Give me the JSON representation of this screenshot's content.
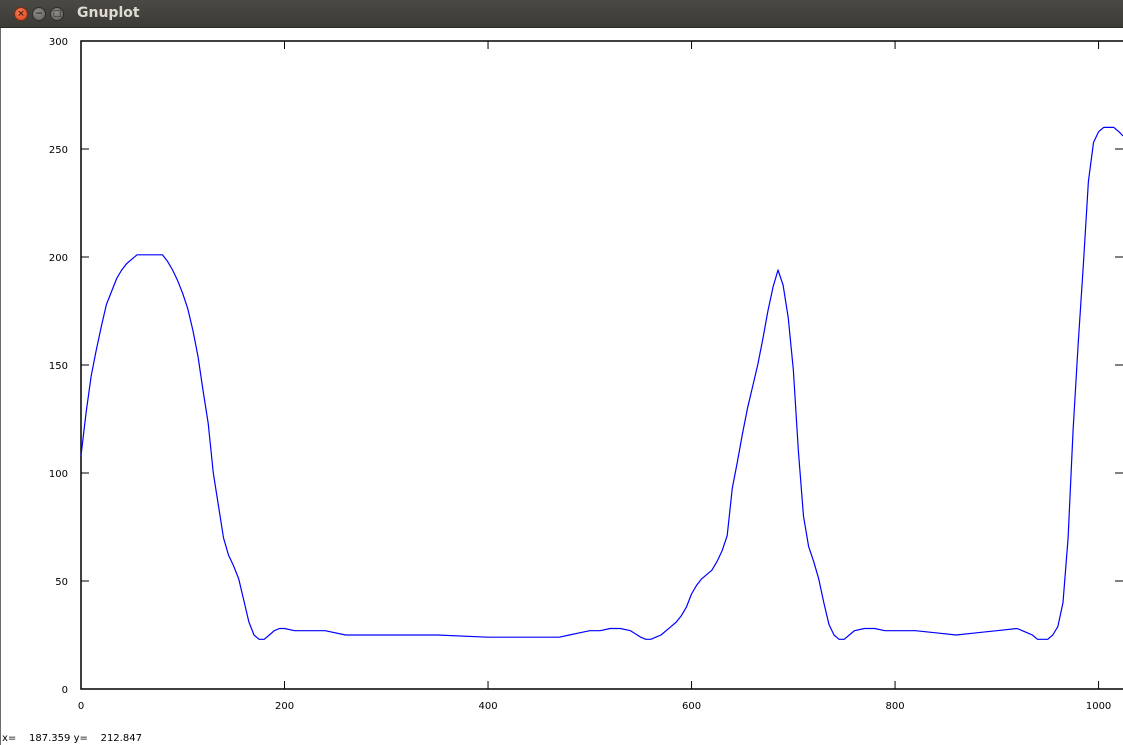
{
  "window": {
    "title": "Gnuplot",
    "buttons": {
      "close": "×",
      "minimize": "−",
      "maximize": "□"
    }
  },
  "statusbar": {
    "x_label": "x=",
    "x_value": "187.359",
    "y_label": "y=",
    "y_value": "212.847"
  },
  "chart_data": {
    "type": "line",
    "title": "",
    "xlabel": "",
    "ylabel": "",
    "xlim": [
      0,
      1024
    ],
    "ylim": [
      0,
      300
    ],
    "xticks": [
      0,
      200,
      400,
      600,
      800,
      1000
    ],
    "yticks": [
      0,
      50,
      100,
      150,
      200,
      250,
      300
    ],
    "grid": false,
    "line_color": "#0000ff",
    "series": [
      {
        "x": [
          0,
          5,
          10,
          15,
          20,
          25,
          30,
          35,
          40,
          45,
          50,
          55,
          60,
          70,
          80,
          85,
          90,
          95,
          100,
          105,
          110,
          115,
          120,
          125,
          130,
          135,
          140,
          145,
          150,
          155,
          160,
          165,
          170,
          175,
          180,
          185,
          190,
          195,
          200,
          210,
          220,
          240,
          260,
          280,
          300,
          350,
          400,
          450,
          470,
          480,
          490,
          500,
          510,
          520,
          530,
          540,
          550,
          555,
          560,
          570,
          580,
          585,
          590,
          595,
          600,
          605,
          610,
          620,
          625,
          630,
          635,
          640,
          645,
          650,
          655,
          660,
          665,
          670,
          675,
          680,
          685,
          690,
          695,
          700,
          705,
          710,
          715,
          720,
          725,
          730,
          735,
          740,
          745,
          750,
          755,
          760,
          770,
          780,
          790,
          800,
          820,
          840,
          860,
          880,
          900,
          920,
          925,
          930,
          935,
          940,
          945,
          950,
          955,
          960,
          965,
          970,
          975,
          980,
          985,
          990,
          995,
          1000,
          1005,
          1010,
          1015,
          1020,
          1024
        ],
        "y": [
          108,
          128,
          145,
          157,
          168,
          178,
          184,
          190,
          194,
          197,
          199,
          201,
          201,
          201,
          201,
          198,
          194,
          189,
          183,
          176,
          166,
          154,
          138,
          123,
          100,
          85,
          70,
          62,
          57,
          51,
          41,
          31,
          25,
          23,
          23,
          25,
          27,
          28,
          28,
          27,
          27,
          27,
          25,
          25,
          25,
          25,
          24,
          24,
          24,
          25,
          26,
          27,
          27,
          28,
          28,
          27,
          24,
          23,
          23,
          25,
          29,
          31,
          34,
          38,
          44,
          48,
          51,
          55,
          59,
          64,
          71,
          93,
          105,
          118,
          130,
          140,
          150,
          162,
          175,
          186,
          194,
          187,
          172,
          148,
          110,
          80,
          66,
          59,
          51,
          40,
          30,
          25,
          23,
          23,
          25,
          27,
          28,
          28,
          27,
          27,
          27,
          26,
          25,
          26,
          27,
          28,
          27,
          26,
          25,
          23,
          23,
          23,
          25,
          29,
          40,
          70,
          120,
          160,
          196,
          235,
          253,
          258,
          260,
          260,
          260,
          258,
          256
        ]
      }
    ]
  }
}
